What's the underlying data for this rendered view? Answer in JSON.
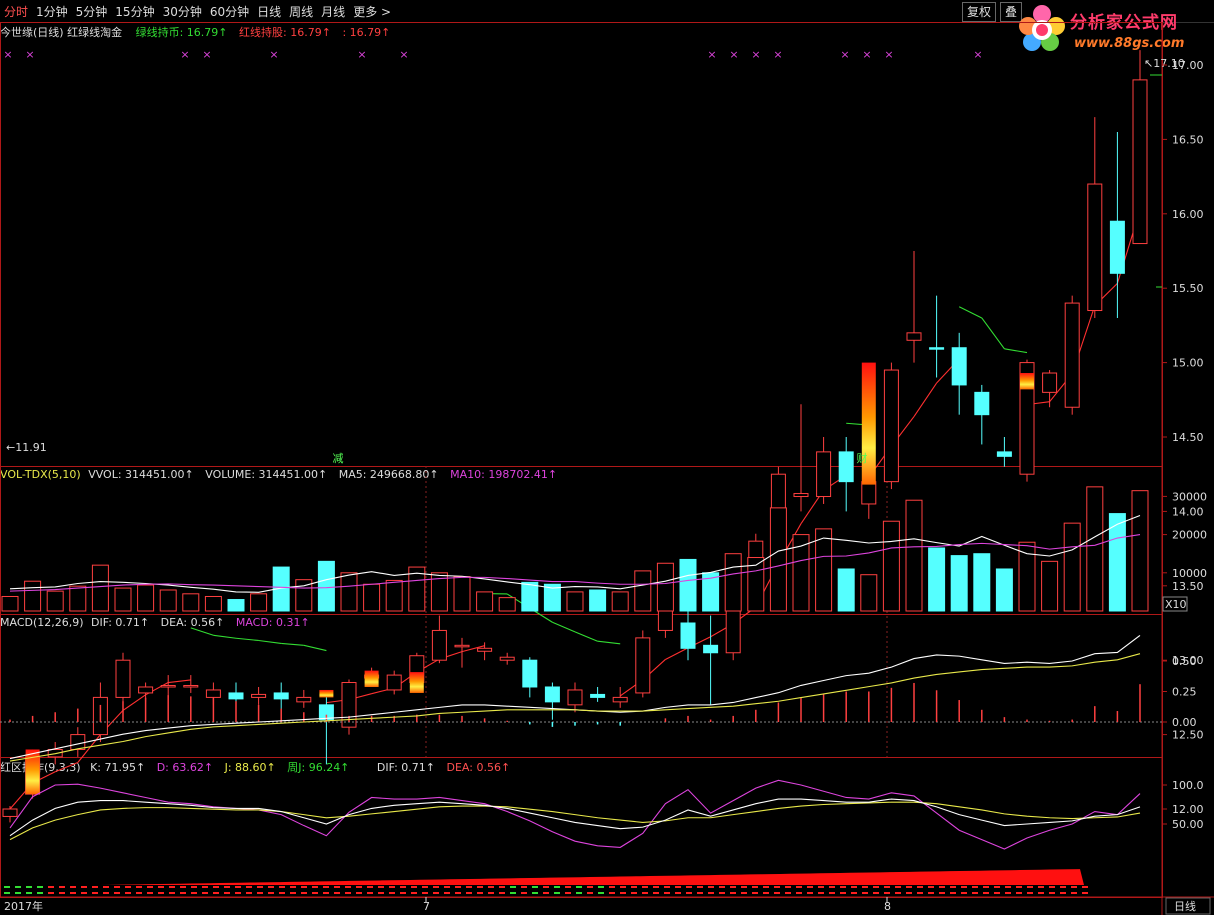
{
  "toolbar": {
    "timeframes": [
      "分时",
      "1分钟",
      "5分钟",
      "15分钟",
      "30分钟",
      "60分钟",
      "日线",
      "周线",
      "月线",
      "更多 >"
    ],
    "restore_label": "复权",
    "extra_label": "叠"
  },
  "logo": {
    "title": "分析家公式网",
    "url": "www.88gs.com"
  },
  "price_panel": {
    "title": "今世缘(日线) 红绿线淘金",
    "green_line": "绿线持币: 16.79↑",
    "red_line": "红线持股: 16.79↑",
    "value": ": 16.79↑",
    "high_label": "17.10",
    "low_label": "11.91",
    "signal_left": "减",
    "signal_right": "财",
    "y_ticks": [
      "17.00",
      "16.50",
      "16.00",
      "15.50",
      "15.00",
      "14.50",
      "14.00",
      "13.50",
      "13.00",
      "12.50",
      "12.00"
    ]
  },
  "volume_panel": {
    "title": "VOL-TDX(5,10)",
    "vvol": "VVOL: 314451.00↑",
    "volume": "VOLUME: 314451.00↑",
    "ma5": "MA5: 249668.80↑",
    "ma10": "MA10: 198702.41↑",
    "y_ticks": [
      "30000",
      "20000",
      "10000"
    ],
    "unit": "X10"
  },
  "macd_panel": {
    "title": "MACD(12,26,9)",
    "dif": "DIF: 0.71↑",
    "dea": "DEA: 0.56↑",
    "macd": "MACD: 0.31↑",
    "y_ticks": [
      "0.50",
      "0.25",
      "0.00"
    ]
  },
  "kdj_panel": {
    "title": "红区操作(9,3,3)",
    "k": "K: 71.95↑",
    "d": "D: 63.62↑",
    "j": "J: 88.60↑",
    "wj": "周J: 96.24↑",
    "dif": "DIF: 0.71↑",
    "dea": "DEA: 0.56↑",
    "y_ticks": [
      "100.0",
      "50.00"
    ]
  },
  "x_axis": {
    "labels": [
      "2017年",
      "7",
      "8"
    ],
    "period": "日线"
  },
  "chart_data": {
    "type": "candlestick",
    "candles": [
      {
        "o": 11.95,
        "h": 12.02,
        "l": 11.91,
        "c": 12.0,
        "up": true
      },
      {
        "o": 12.1,
        "h": 12.4,
        "l": 12.07,
        "c": 12.35,
        "up": true
      },
      {
        "o": 12.35,
        "h": 12.45,
        "l": 12.3,
        "c": 12.4,
        "up": true
      },
      {
        "o": 12.4,
        "h": 12.55,
        "l": 12.35,
        "c": 12.5,
        "up": true
      },
      {
        "o": 12.5,
        "h": 12.85,
        "l": 12.45,
        "c": 12.75,
        "up": true
      },
      {
        "o": 12.75,
        "h": 13.05,
        "l": 12.7,
        "c": 13.0,
        "up": true
      },
      {
        "o": 12.78,
        "h": 12.85,
        "l": 12.72,
        "c": 12.82,
        "up": true
      },
      {
        "o": 12.82,
        "h": 12.9,
        "l": 12.75,
        "c": 12.83,
        "up": true
      },
      {
        "o": 12.83,
        "h": 12.9,
        "l": 12.78,
        "c": 12.82,
        "up": true
      },
      {
        "o": 12.75,
        "h": 12.85,
        "l": 12.7,
        "c": 12.8,
        "up": true
      },
      {
        "o": 12.78,
        "h": 12.85,
        "l": 12.7,
        "c": 12.74,
        "up": false
      },
      {
        "o": 12.75,
        "h": 12.82,
        "l": 12.7,
        "c": 12.77,
        "up": true
      },
      {
        "o": 12.78,
        "h": 12.85,
        "l": 12.6,
        "c": 12.74,
        "up": false
      },
      {
        "o": 12.72,
        "h": 12.8,
        "l": 12.68,
        "c": 12.75,
        "up": true
      },
      {
        "o": 12.7,
        "h": 12.78,
        "l": 12.3,
        "c": 12.6,
        "up": false
      },
      {
        "o": 12.55,
        "h": 12.87,
        "l": 12.5,
        "c": 12.85,
        "up": true
      },
      {
        "o": 12.88,
        "h": 12.95,
        "l": 12.83,
        "c": 12.9,
        "up": true
      },
      {
        "o": 12.8,
        "h": 12.93,
        "l": 12.77,
        "c": 12.9,
        "up": true
      },
      {
        "o": 12.85,
        "h": 13.05,
        "l": 12.82,
        "c": 13.03,
        "up": true
      },
      {
        "o": 13.0,
        "h": 13.3,
        "l": 12.98,
        "c": 13.2,
        "up": true
      },
      {
        "o": 13.1,
        "h": 13.15,
        "l": 12.95,
        "c": 13.1,
        "up": true
      },
      {
        "o": 13.08,
        "h": 13.12,
        "l": 13.0,
        "c": 13.06,
        "up": true
      },
      {
        "o": 13.0,
        "h": 13.05,
        "l": 12.97,
        "c": 13.02,
        "up": true
      },
      {
        "o": 13.0,
        "h": 13.02,
        "l": 12.75,
        "c": 12.82,
        "up": false
      },
      {
        "o": 12.82,
        "h": 12.85,
        "l": 12.6,
        "c": 12.72,
        "up": false
      },
      {
        "o": 12.7,
        "h": 12.85,
        "l": 12.65,
        "c": 12.8,
        "up": true
      },
      {
        "o": 12.75,
        "h": 12.82,
        "l": 12.72,
        "c": 12.77,
        "up": false
      },
      {
        "o": 12.72,
        "h": 12.82,
        "l": 12.68,
        "c": 12.75,
        "up": true
      },
      {
        "o": 12.78,
        "h": 13.2,
        "l": 12.75,
        "c": 13.15,
        "up": true
      },
      {
        "o": 13.2,
        "h": 13.38,
        "l": 13.15,
        "c": 13.35,
        "up": true
      },
      {
        "o": 13.25,
        "h": 13.5,
        "l": 13.0,
        "c": 13.08,
        "up": false
      },
      {
        "o": 13.1,
        "h": 13.3,
        "l": 12.7,
        "c": 13.05,
        "up": false
      },
      {
        "o": 13.05,
        "h": 13.6,
        "l": 13.0,
        "c": 13.5,
        "up": true
      },
      {
        "o": 13.55,
        "h": 13.85,
        "l": 13.45,
        "c": 13.8,
        "up": true
      },
      {
        "o": 13.85,
        "h": 14.3,
        "l": 13.8,
        "c": 14.25,
        "up": true
      },
      {
        "o": 14.1,
        "h": 14.72,
        "l": 14.0,
        "c": 14.12,
        "up": true
      },
      {
        "o": 14.1,
        "h": 14.5,
        "l": 14.05,
        "c": 14.4,
        "up": true
      },
      {
        "o": 14.4,
        "h": 14.5,
        "l": 14.0,
        "c": 14.2,
        "up": false
      },
      {
        "o": 14.05,
        "h": 14.3,
        "l": 13.95,
        "c": 14.2,
        "up": true
      },
      {
        "o": 14.2,
        "h": 15.0,
        "l": 14.15,
        "c": 14.95,
        "up": true
      },
      {
        "o": 15.15,
        "h": 15.75,
        "l": 15.0,
        "c": 15.2,
        "up": true
      },
      {
        "o": 15.1,
        "h": 15.45,
        "l": 14.9,
        "c": 15.1,
        "up": false
      },
      {
        "o": 15.1,
        "h": 15.2,
        "l": 14.65,
        "c": 14.85,
        "up": false
      },
      {
        "o": 14.8,
        "h": 14.85,
        "l": 14.45,
        "c": 14.65,
        "up": false
      },
      {
        "o": 14.4,
        "h": 14.5,
        "l": 14.3,
        "c": 14.37,
        "up": false
      },
      {
        "o": 14.25,
        "h": 15.02,
        "l": 14.2,
        "c": 15.0,
        "up": true
      },
      {
        "o": 14.8,
        "h": 14.95,
        "l": 14.7,
        "c": 14.93,
        "up": true
      },
      {
        "o": 14.7,
        "h": 15.45,
        "l": 14.65,
        "c": 15.4,
        "up": true
      },
      {
        "o": 15.35,
        "h": 16.65,
        "l": 15.3,
        "c": 16.2,
        "up": true
      },
      {
        "o": 15.95,
        "h": 16.55,
        "l": 15.3,
        "c": 15.6,
        "up": false
      },
      {
        "o": 15.8,
        "h": 17.1,
        "l": 15.8,
        "c": 16.9,
        "up": true
      }
    ],
    "volume": [
      3.8,
      7.8,
      5.2,
      6.5,
      12.0,
      6.0,
      6.8,
      5.5,
      4.5,
      3.8,
      3.0,
      4.5,
      11.5,
      8.2,
      13.0,
      10.0,
      7.0,
      8.0,
      11.5,
      10.0,
      9.0,
      5.0,
      3.5,
      7.5,
      7.0,
      5.0,
      5.5,
      5.0,
      10.5,
      12.5,
      13.5,
      10.0,
      15.0,
      14.0,
      27.0,
      20.0,
      21.5,
      11.0,
      9.5,
      23.5,
      29.0,
      16.5,
      14.5,
      15.0,
      11.0,
      18.0,
      13.0,
      23.0,
      32.5,
      25.5,
      31.5
    ],
    "macd_bars": [
      0.02,
      0.05,
      0.08,
      0.11,
      0.14,
      0.17,
      0.2,
      0.22,
      0.21,
      0.2,
      0.17,
      0.14,
      0.11,
      0.08,
      0.06,
      0.05,
      0.05,
      0.05,
      0.06,
      0.06,
      0.05,
      0.03,
      0.01,
      -0.02,
      -0.04,
      -0.03,
      -0.02,
      -0.03,
      0.0,
      0.03,
      0.05,
      0.02,
      0.05,
      0.1,
      0.16,
      0.2,
      0.23,
      0.25,
      0.25,
      0.28,
      0.32,
      0.26,
      0.18,
      0.1,
      0.04,
      0.02,
      0.01,
      0.02,
      0.13,
      0.09,
      0.31
    ],
    "dif": [
      -0.3,
      -0.26,
      -0.22,
      -0.18,
      -0.14,
      -0.1,
      -0.07,
      -0.05,
      -0.03,
      -0.02,
      -0.01,
      0.0,
      0.01,
      0.02,
      0.03,
      0.04,
      0.06,
      0.08,
      0.1,
      0.12,
      0.14,
      0.14,
      0.13,
      0.12,
      0.11,
      0.1,
      0.09,
      0.08,
      0.09,
      0.12,
      0.14,
      0.14,
      0.16,
      0.2,
      0.24,
      0.3,
      0.34,
      0.38,
      0.4,
      0.45,
      0.52,
      0.55,
      0.54,
      0.51,
      0.48,
      0.49,
      0.48,
      0.5,
      0.56,
      0.57,
      0.71
    ],
    "dea": [
      -0.32,
      -0.29,
      -0.26,
      -0.22,
      -0.19,
      -0.16,
      -0.12,
      -0.09,
      -0.06,
      -0.04,
      -0.03,
      -0.02,
      -0.01,
      0.0,
      0.01,
      0.02,
      0.03,
      0.04,
      0.05,
      0.07,
      0.08,
      0.09,
      0.1,
      0.1,
      0.1,
      0.1,
      0.09,
      0.09,
      0.09,
      0.1,
      0.11,
      0.12,
      0.13,
      0.15,
      0.17,
      0.2,
      0.23,
      0.26,
      0.29,
      0.32,
      0.36,
      0.39,
      0.41,
      0.43,
      0.44,
      0.45,
      0.45,
      0.46,
      0.49,
      0.51,
      0.56
    ],
    "k": [
      35,
      55,
      70,
      78,
      80,
      80,
      78,
      76,
      74,
      71,
      70,
      70,
      66,
      58,
      50,
      62,
      70,
      74,
      76,
      78,
      76,
      74,
      70,
      64,
      58,
      52,
      48,
      44,
      46,
      55,
      68,
      60,
      68,
      76,
      82,
      82,
      80,
      78,
      78,
      82,
      80,
      72,
      62,
      55,
      48,
      50,
      52,
      54,
      60,
      62,
      72
    ],
    "d": [
      30,
      45,
      55,
      62,
      68,
      70,
      71,
      71,
      70,
      69,
      68,
      68,
      66,
      62,
      58,
      60,
      63,
      66,
      69,
      72,
      73,
      73,
      72,
      69,
      66,
      62,
      58,
      55,
      52,
      54,
      58,
      58,
      62,
      66,
      70,
      73,
      75,
      76,
      77,
      78,
      78,
      76,
      72,
      68,
      63,
      60,
      58,
      57,
      58,
      59,
      64
    ],
    "j": [
      45,
      85,
      100,
      101,
      96,
      90,
      84,
      78,
      76,
      72,
      70,
      68,
      62,
      48,
      35,
      65,
      84,
      82,
      82,
      84,
      80,
      76,
      66,
      54,
      40,
      28,
      22,
      20,
      38,
      76,
      94,
      64,
      80,
      96,
      106,
      100,
      92,
      84,
      82,
      90,
      86,
      64,
      42,
      30,
      18,
      32,
      42,
      50,
      66,
      62,
      89
    ],
    "ma5_vol": [
      5.8,
      6.1,
      6.3,
      7.2,
      7.7,
      7.5,
      7.2,
      6.8,
      6.2,
      5.7,
      5.0,
      4.9,
      6.0,
      6.6,
      8.2,
      9.4,
      10.3,
      9.3,
      9.9,
      9.3,
      9.1,
      8.4,
      7.6,
      6.9,
      6.0,
      6.4,
      6.3,
      5.8,
      6.8,
      7.8,
      9.3,
      10.1,
      11.5,
      12.0,
      15.7,
      17.0,
      19.1,
      18.5,
      17.8,
      18.2,
      18.9,
      17.9,
      17.0,
      19.5,
      17.2,
      15.0,
      14.4,
      16.0,
      19.4,
      22.7,
      25.0
    ],
    "ma10_vol": [
      5.2,
      5.4,
      5.6,
      6.0,
      6.4,
      6.8,
      7.0,
      7.1,
      6.9,
      6.8,
      6.6,
      6.4,
      6.2,
      6.0,
      6.1,
      6.5,
      7.0,
      7.5,
      8.0,
      8.5,
      8.8,
      8.8,
      8.5,
      8.1,
      7.7,
      7.7,
      7.3,
      7.0,
      7.0,
      7.2,
      8.0,
      8.6,
      9.7,
      10.5,
      11.8,
      13.2,
      14.3,
      14.4,
      15.2,
      16.5,
      16.8,
      16.9,
      17.4,
      17.7,
      17.4,
      17.1,
      16.2,
      16.8,
      17.2,
      19.1,
      20.0
    ]
  }
}
